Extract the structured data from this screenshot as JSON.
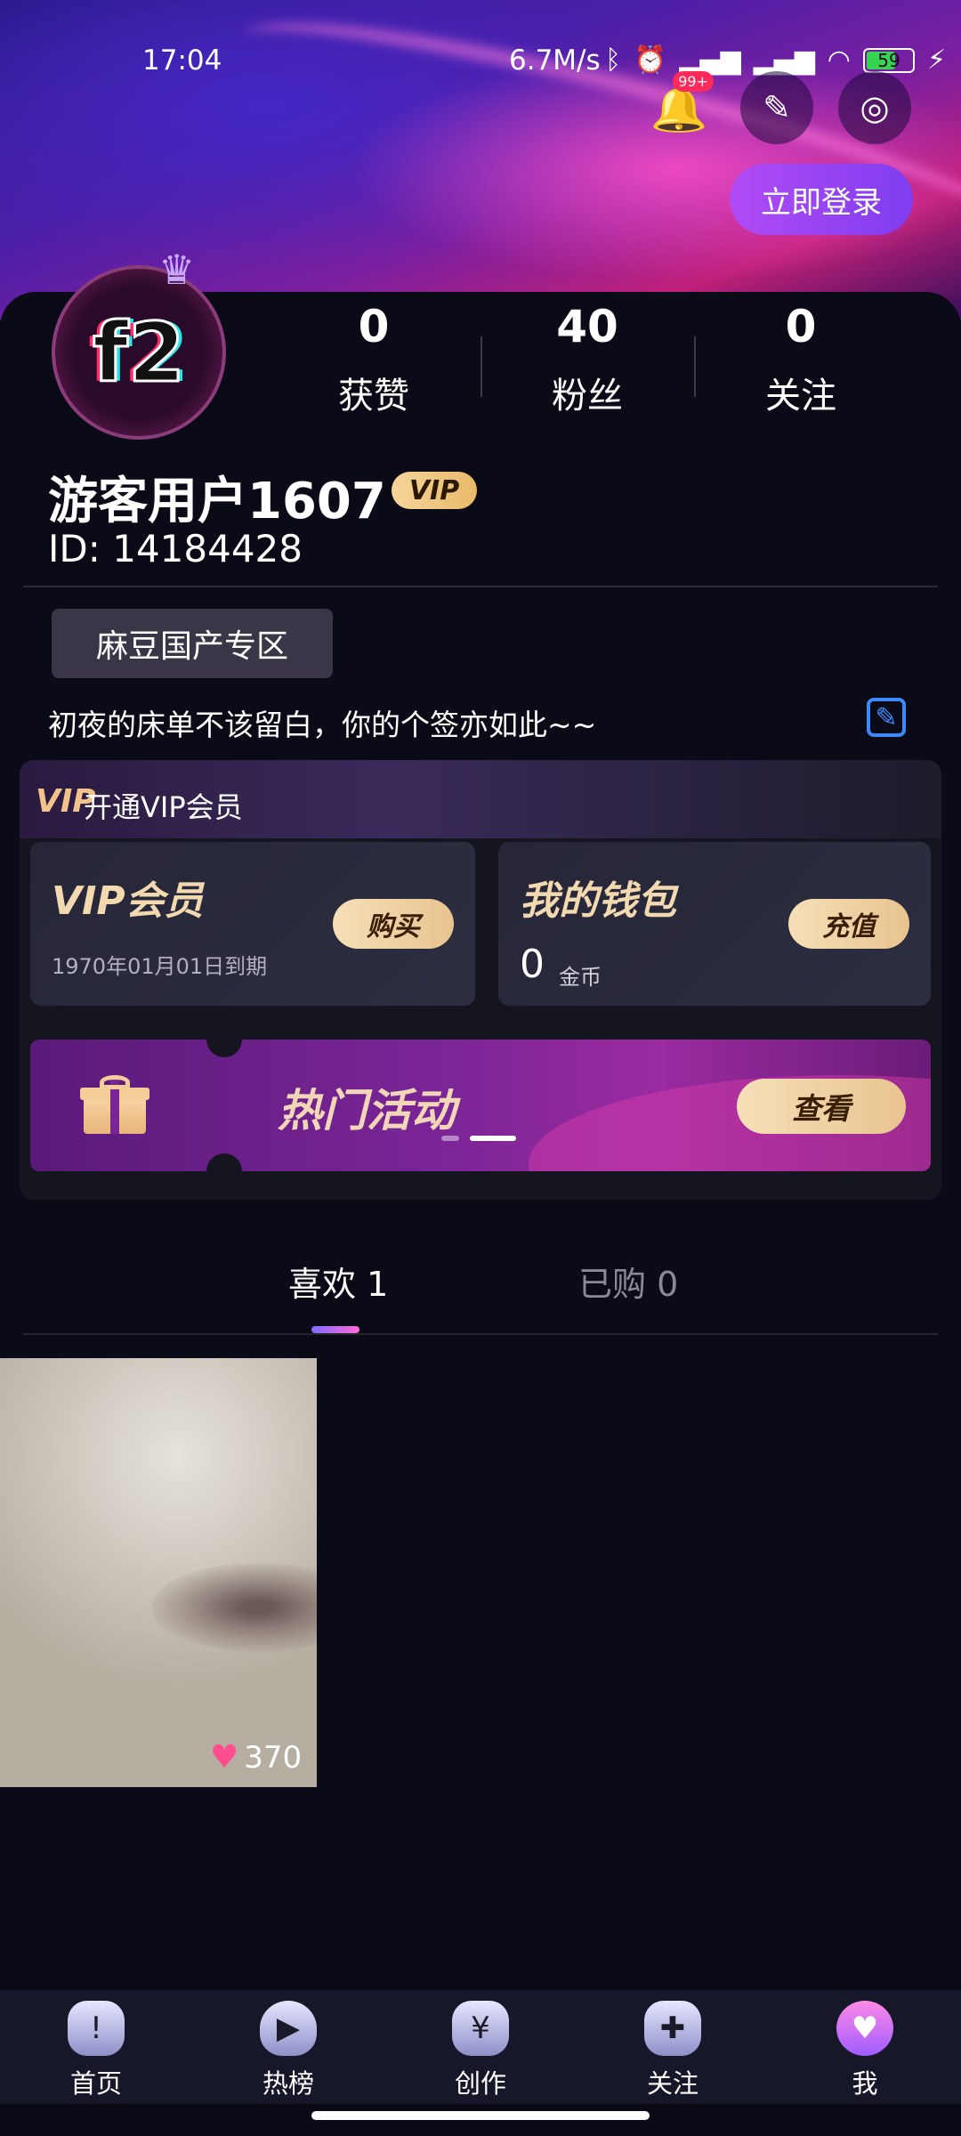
{
  "status_bar": {
    "time": "17:04",
    "speed": "6.7M/s",
    "battery": "59",
    "notification_badge": "99+"
  },
  "header": {
    "login_label": "立即登录"
  },
  "profile": {
    "avatar_text": "f2",
    "stats": [
      {
        "value": "0",
        "label": "获赞"
      },
      {
        "value": "40",
        "label": "粉丝"
      },
      {
        "value": "0",
        "label": "关注"
      }
    ],
    "username": "游客用户1607",
    "vip_badge": "VIP",
    "id_label": "ID: 14184428",
    "zone_button": "麻豆国产专区",
    "signature": "初夜的床单不该留白，你的个签亦如此~~"
  },
  "vip": {
    "header_logo": "VIP",
    "header_label": "开通VIP会员",
    "member_title": "VIP会员",
    "member_expiry": "1970年01月01日到期",
    "buy_label": "购买",
    "wallet_title": "我的钱包",
    "wallet_amount": "0",
    "wallet_unit": "金币",
    "recharge_label": "充值"
  },
  "promo": {
    "title": "热门活动",
    "view_label": "查看"
  },
  "tabs": [
    {
      "label": "喜欢 1",
      "active": true
    },
    {
      "label": "已购 0",
      "active": false
    }
  ],
  "videos": [
    {
      "likes": "370"
    }
  ],
  "bottom_nav": [
    {
      "label": "首页",
      "icon": "home-icon"
    },
    {
      "label": "热榜",
      "icon": "trending-icon"
    },
    {
      "label": "创作",
      "icon": "create-icon"
    },
    {
      "label": "关注",
      "icon": "follow-icon"
    },
    {
      "label": "我",
      "icon": "me-icon"
    }
  ],
  "colors": {
    "accent": "#8b45f2",
    "gold": "#e8c48f",
    "background": "#0b0b17",
    "tab_active_gradient": "#7f6cff"
  }
}
